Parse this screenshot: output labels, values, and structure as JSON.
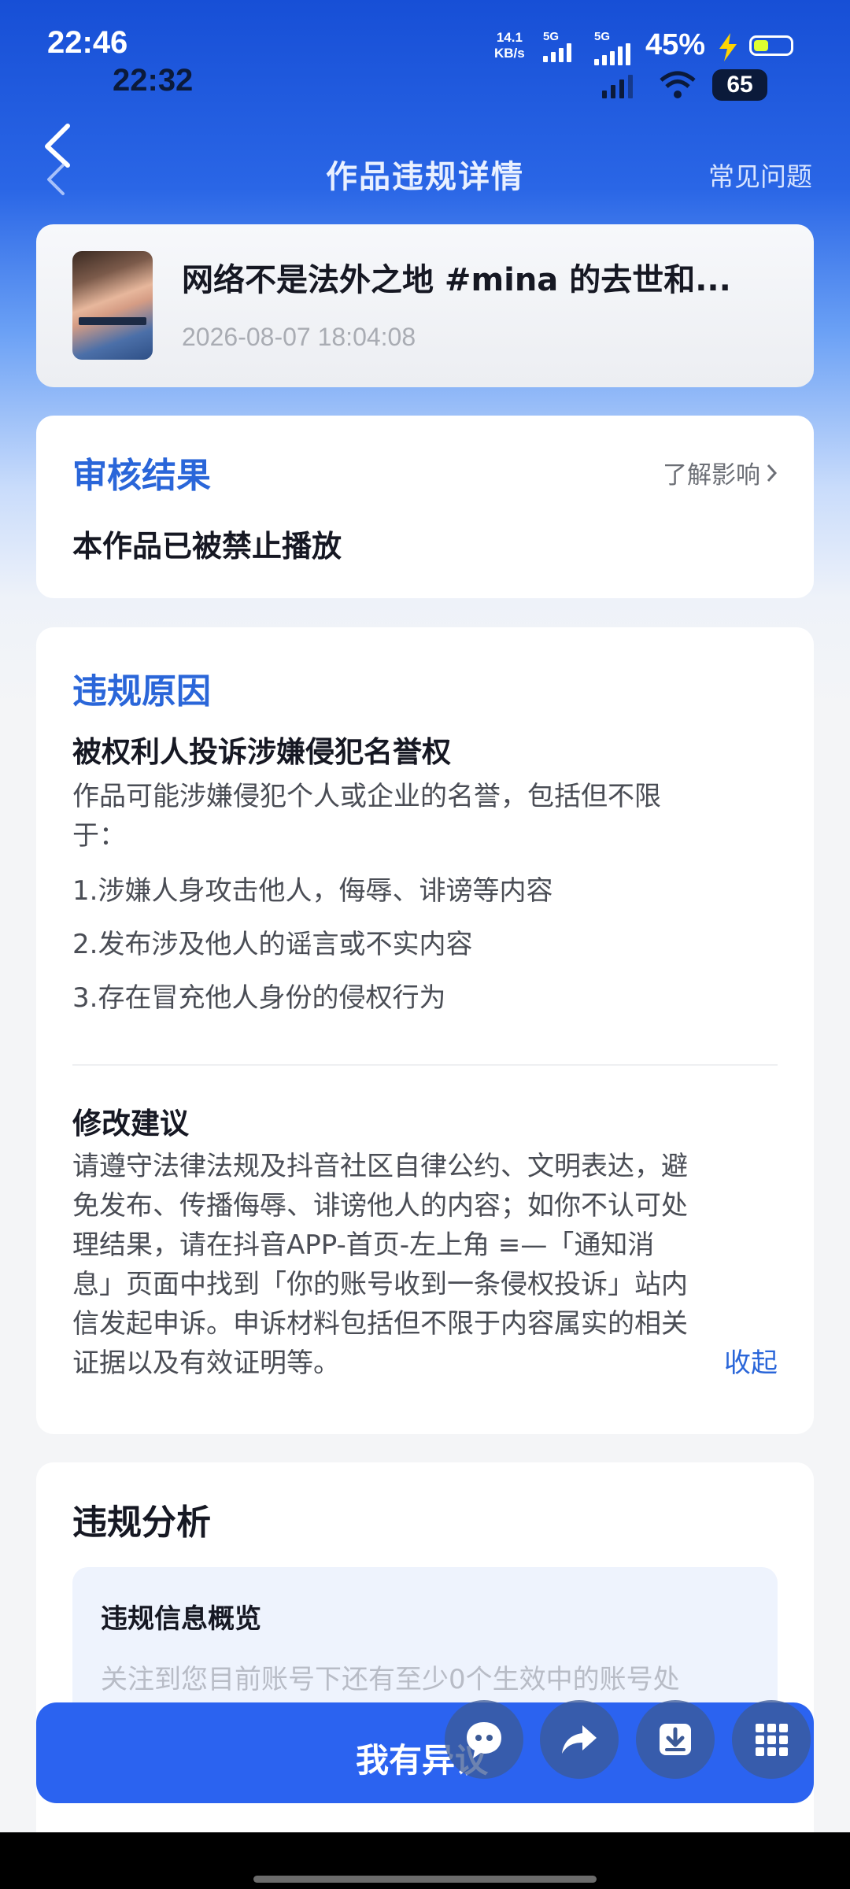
{
  "status_bar": {
    "time": "22:46",
    "time_secondary": "22:32",
    "net_speed_value": "14.1",
    "net_speed_unit": "KB/s",
    "sim1_label": "5G",
    "sim2_label": "5G",
    "battery_pct": "45%",
    "battery_secondary": "65"
  },
  "nav": {
    "title": "作品违规详情",
    "faq_label": "常见问题"
  },
  "work": {
    "title": "网络不是法外之地 #mina 的去世和...",
    "date": "2026-08-07 18:04:08"
  },
  "result": {
    "title": "审核结果",
    "learn_impact": "了解影响",
    "status": "本作品已被禁止播放"
  },
  "reason": {
    "title": "违规原因",
    "subtitle": "被权利人投诉涉嫌侵犯名誉权",
    "desc_line1": "作品可能涉嫌侵犯个人或企业的名誉，包括但不限",
    "desc_line2": "于：",
    "items": [
      "1.涉嫌人身攻击他人，侮辱、诽谤等内容",
      "2.发布涉及他人的谣言或不实内容",
      "3.存在冒充他人身份的侵权行为"
    ],
    "advice_title": "修改建议",
    "advice_lines": [
      "请遵守法律法规及抖音社区自律公约、文明表达，避",
      "免发布、传播侮辱、诽谤他人的内容；如你不认可处",
      "理结果，请在抖音APP-首页-左上角 ≡—「通知消",
      "息」页面中找到「你的账号收到一条侵权投诉」站内",
      "信发起申诉。申诉材料包括但不限于内容属实的相关",
      "证据以及有效证明等。"
    ],
    "collapse_label": "收起"
  },
  "analysis": {
    "title": "违规分析",
    "overview_title": "违规信息概览",
    "overview_text": "关注到您目前账号下还有至少0个生效中的账号处"
  },
  "appeal": {
    "label": "我有异议"
  },
  "colors": {
    "accent_blue": "#2a66d9",
    "button_blue": "#2b63f0"
  },
  "icons": {
    "fab1": "quote-bubble-icon",
    "fab2": "share-arrow-icon",
    "fab3": "download-icon",
    "fab4": "grid-menu-icon"
  }
}
